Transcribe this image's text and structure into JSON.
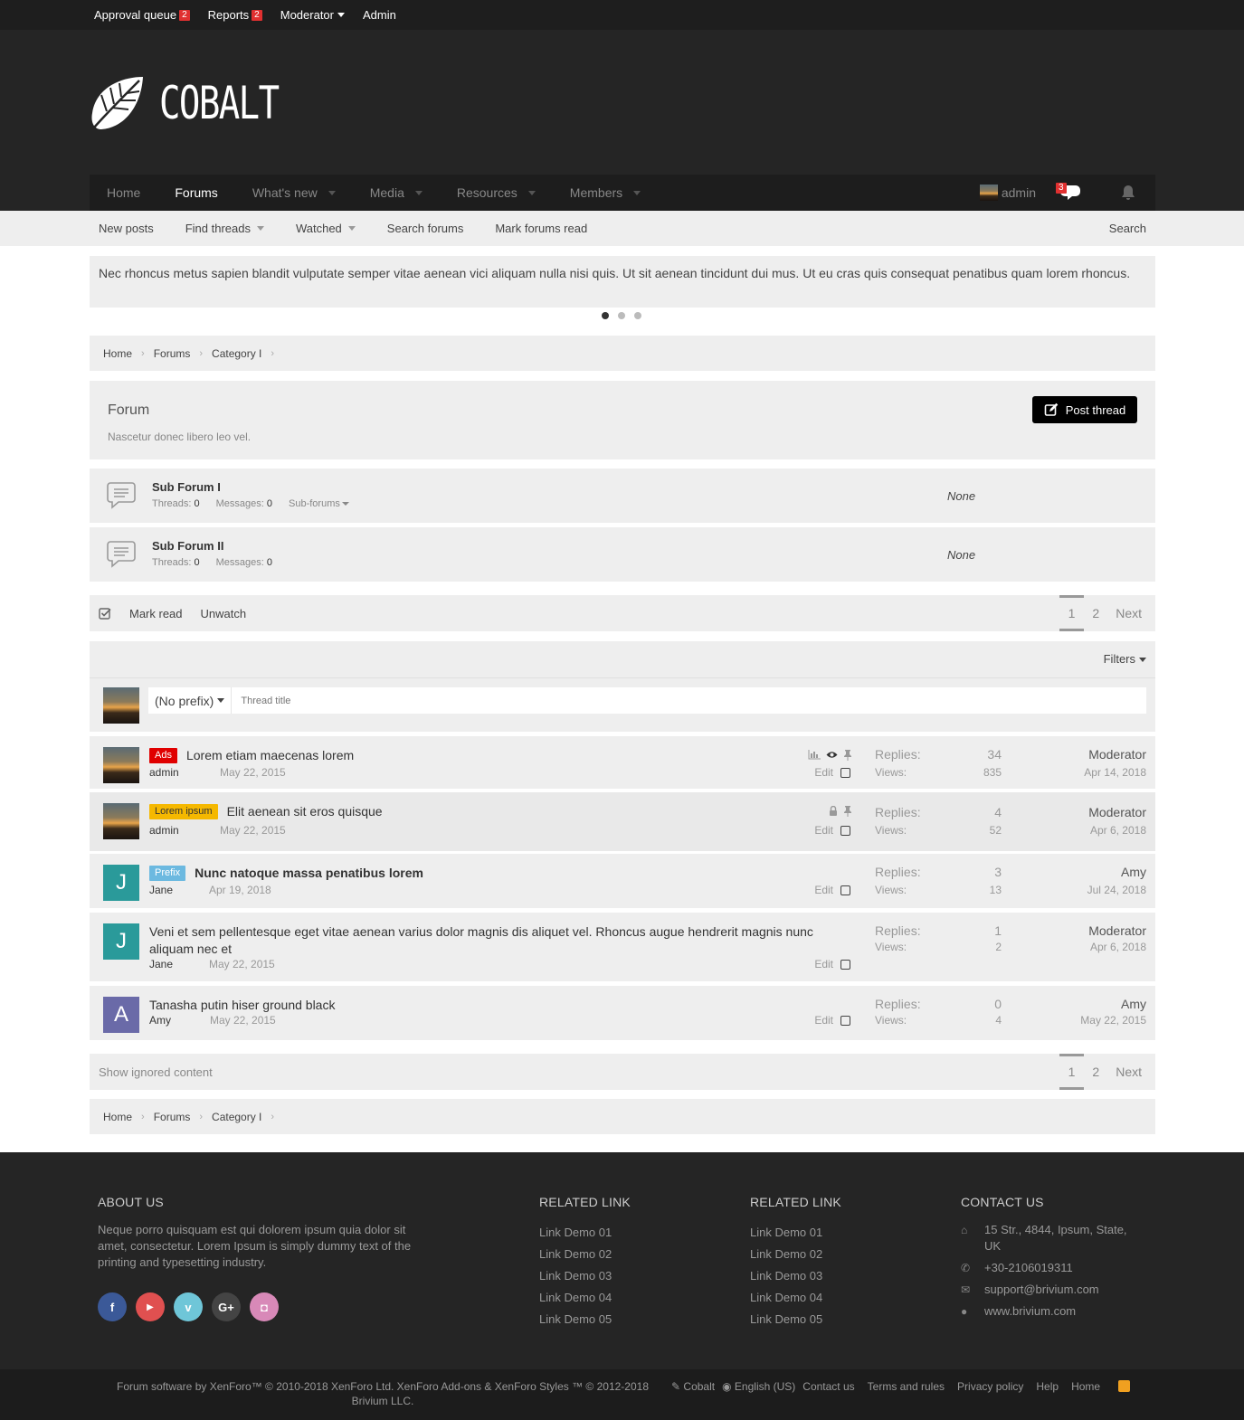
{
  "topbar": {
    "approval_queue": "Approval queue",
    "approval_count": "2",
    "reports": "Reports",
    "reports_count": "2",
    "moderator": "Moderator",
    "admin": "Admin"
  },
  "logo": {
    "text": "COBALT"
  },
  "nav": {
    "items": [
      "Home",
      "Forums",
      "What's new",
      "Media",
      "Resources",
      "Members"
    ],
    "user": "admin",
    "conversations_count": "3"
  },
  "subnav": {
    "items": [
      "New posts",
      "Find threads",
      "Watched",
      "Search forums",
      "Mark forums read"
    ],
    "search": "Search"
  },
  "notice": {
    "text": "Nec rhoncus metus sapien blandit vulputate semper vitae aenean vici aliquam nulla nisi quis. Ut sit aenean tincidunt dui mus. Ut eu cras quis consequat penatibus quam lorem rhoncus."
  },
  "breadcrumb": [
    "Home",
    "Forums",
    "Category I"
  ],
  "forum": {
    "title": "Forum",
    "description": "Nascetur donec libero leo vel.",
    "post_thread": "Post thread"
  },
  "subforums": [
    {
      "name": "Sub Forum I",
      "threads_label": "Threads:",
      "threads": "0",
      "messages_label": "Messages:",
      "messages": "0",
      "subforums": "Sub-forums",
      "last": "None"
    },
    {
      "name": "Sub Forum II",
      "threads_label": "Threads:",
      "threads": "0",
      "messages_label": "Messages:",
      "messages": "0",
      "last": "None"
    }
  ],
  "actions": {
    "mark_read": "Mark read",
    "unwatch": "Unwatch"
  },
  "pager": {
    "page1": "1",
    "page2": "2",
    "next": "Next"
  },
  "filters": {
    "label": "Filters"
  },
  "new_thread": {
    "prefix": "(No prefix)",
    "placeholder": "Thread title"
  },
  "threads": [
    {
      "prefix": "Ads",
      "prefix_bg": "#e00000",
      "prefix_fg": "#ffffff",
      "title": "Lorem etiam maecenas lorem",
      "author": "admin",
      "date": "May 22, 2015",
      "edit": "Edit",
      "replies_label": "Replies:",
      "replies": "34",
      "views_label": "Views:",
      "views": "835",
      "last_user": "Moderator",
      "last_date": "Apr 14, 2018"
    },
    {
      "prefix": "Lorem ipsum",
      "prefix_bg": "#f5b800",
      "prefix_fg": "#333333",
      "title": "Elit aenean sit eros quisque",
      "author": "admin",
      "date": "May 22, 2015",
      "edit": "Edit",
      "replies_label": "Replies:",
      "replies": "4",
      "views_label": "Views:",
      "views": "52",
      "last_user": "Moderator",
      "last_date": "Apr 6, 2018"
    },
    {
      "prefix": "Prefix",
      "prefix_bg": "#6cb9e0",
      "prefix_fg": "#ffffff",
      "title": "Nunc natoque massa penatibus lorem",
      "author": "Jane",
      "avatar_letter": "J",
      "avatar_color": "#2a9a9a",
      "date": "Apr 19, 2018",
      "edit": "Edit",
      "replies_label": "Replies:",
      "replies": "3",
      "views_label": "Views:",
      "views": "13",
      "last_user": "Amy",
      "last_date": "Jul 24, 2018"
    },
    {
      "title": "Veni et sem pellentesque eget vitae aenean varius dolor magnis dis aliquet vel. Rhoncus augue hendrerit magnis nunc aliquam nec et",
      "author": "Jane",
      "avatar_letter": "J",
      "avatar_color": "#2a9a9a",
      "date": "May 22, 2015",
      "edit": "Edit",
      "replies_label": "Replies:",
      "replies": "1",
      "views_label": "Views:",
      "views": "2",
      "last_user": "Moderator",
      "last_date": "Apr 6, 2018"
    },
    {
      "title": "Tanasha putin hiser ground black",
      "author": "Amy",
      "avatar_letter": "A",
      "avatar_color": "#6a6aa8",
      "date": "May 22, 2015",
      "edit": "Edit",
      "replies_label": "Replies:",
      "replies": "0",
      "views_label": "Views:",
      "views": "4",
      "last_user": "Amy",
      "last_date": "May 22, 2015"
    }
  ],
  "show_ignored": "Show ignored content",
  "footer": {
    "about_title": "ABOUT US",
    "about_text": "Neque porro quisquam est qui dolorem ipsum quia dolor sit amet, consectetur. Lorem Ipsum is simply dummy text of the printing and typesetting industry.",
    "social": [
      {
        "icon": "facebook-icon",
        "glyph": "f",
        "color": "#3b5998"
      },
      {
        "icon": "youtube-icon",
        "glyph": "▶",
        "color": "#e05050"
      },
      {
        "icon": "vimeo-icon",
        "glyph": "v",
        "color": "#6fc6d8"
      },
      {
        "icon": "google-plus-icon",
        "glyph": "G+",
        "color": "#444444"
      },
      {
        "icon": "instagram-icon",
        "glyph": "◘",
        "color": "#d889b8"
      }
    ],
    "related1_title": "RELATED LINK",
    "related1": [
      "Link Demo 01",
      "Link Demo 02",
      "Link Demo 03",
      "Link Demo 04",
      "Link Demo 05"
    ],
    "related2_title": "RELATED LINK",
    "related2": [
      "Link Demo 01",
      "Link Demo 02",
      "Link Demo 03",
      "Link Demo 04",
      "Link Demo 05"
    ],
    "contact_title": "CONTACT US",
    "address": "15 Str., 4844, Ipsum, State, UK",
    "phone": "+30-2106019311",
    "email": "support@brivium.com",
    "website": "www.brivium.com"
  },
  "copyright": {
    "left": "Forum software by XenForo™ © 2010-2018 XenForo Ltd.    XenForo Add-ons & XenForo Styles ™ © 2012-2018 Brivium LLC.",
    "style": "Cobalt",
    "language": "English (US)",
    "links": [
      "Contact us",
      "Terms and rules",
      "Privacy policy",
      "Help",
      "Home"
    ]
  }
}
